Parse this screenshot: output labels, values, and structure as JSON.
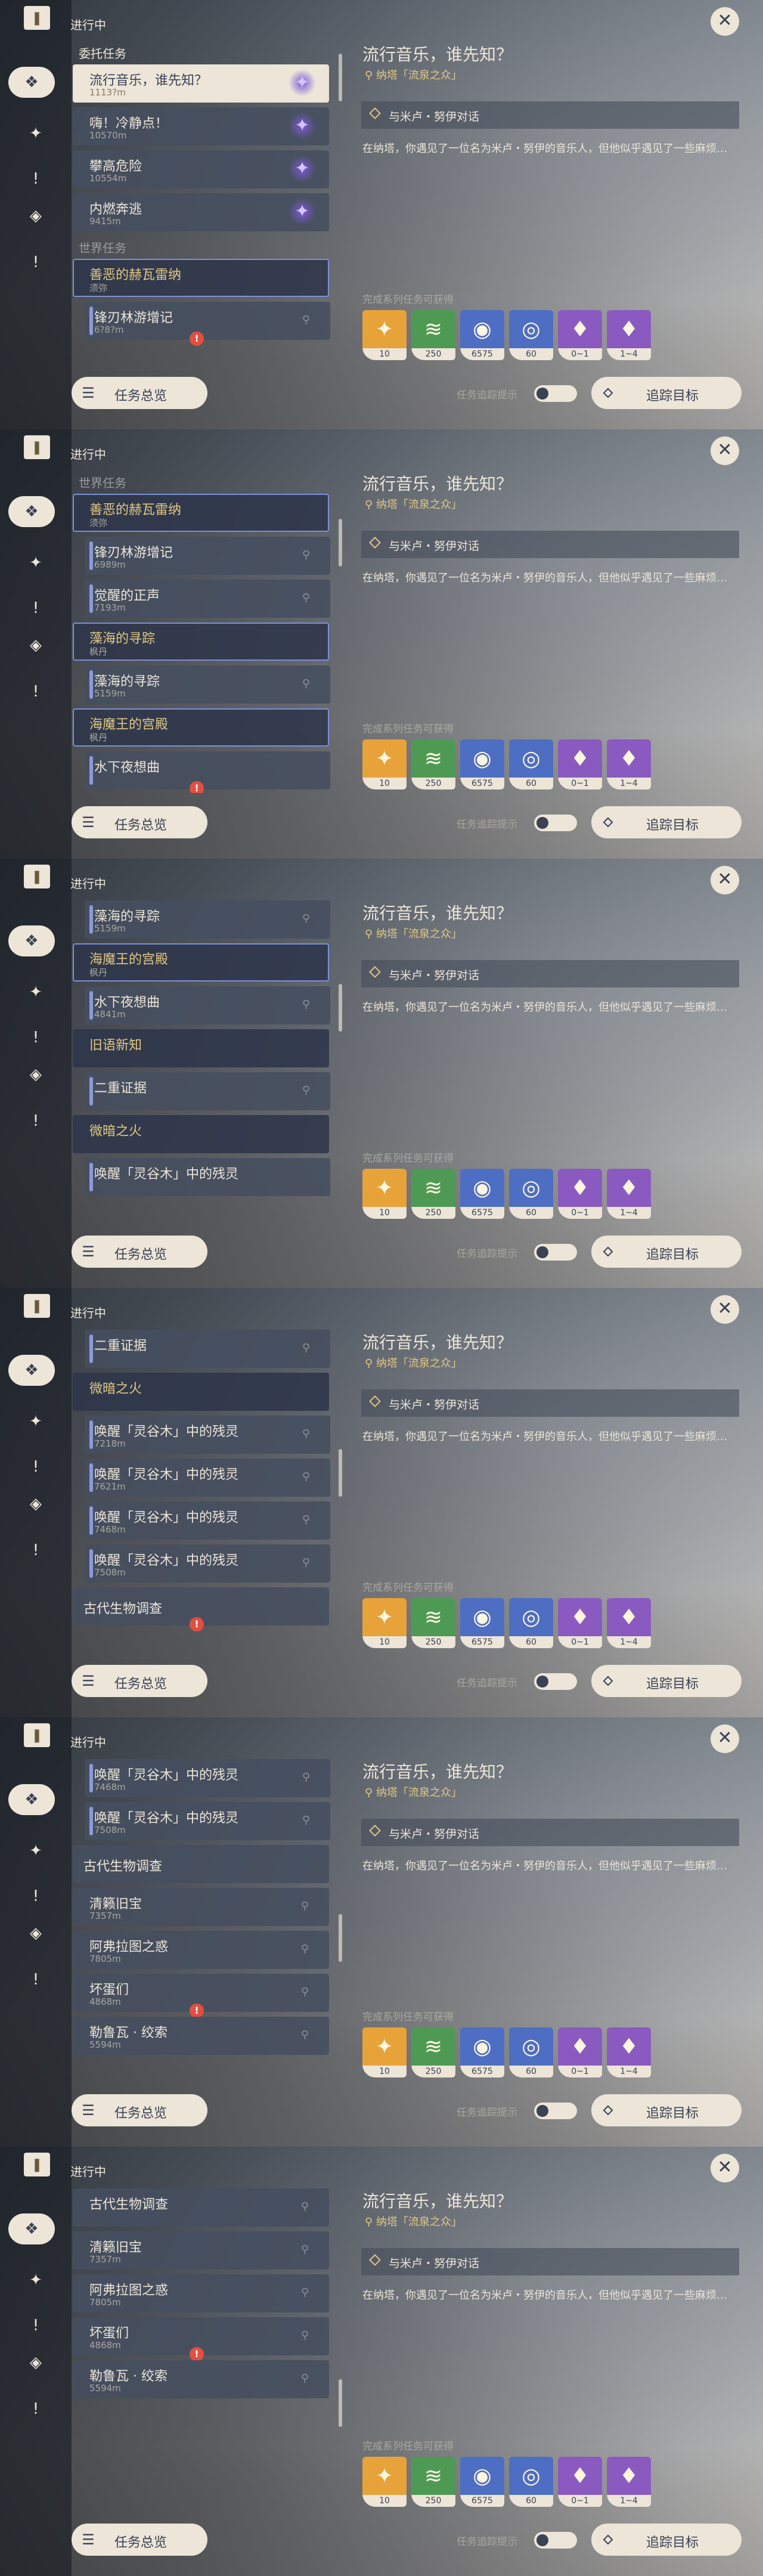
{
  "header": "进行中",
  "bottom_button": "任务总览",
  "close_symbol": "✕",
  "quest": {
    "title": "流行音乐，谁先知？",
    "location": "纳塔「流泉之众」",
    "objective": "与米卢・努伊对话",
    "description": "在纳塔，你遇见了一位名为米卢・努伊的音乐人，但他似乎遇见了一些麻烦…",
    "rewards_label": "完成系列任务可获得",
    "track_toggle_label": "任务追踪提示",
    "track_button": "追踪目标"
  },
  "rewards": [
    {
      "name": "intertwined-fate",
      "count": "10",
      "color": "#e8a23a"
    },
    {
      "name": "adventure-exp",
      "count": "250",
      "color": "#4e9a55"
    },
    {
      "name": "mora",
      "count": "6575",
      "color": "#4d6ec2"
    },
    {
      "name": "companionship-exp",
      "count": "60",
      "color": "#4d6ec2"
    },
    {
      "name": "crystal-fragment",
      "count": "0~1",
      "color": "#8a5ac0"
    },
    {
      "name": "crystal-chunk",
      "count": "1~4",
      "color": "#8a5ac0"
    }
  ],
  "rail_icons": [
    "quest-book-icon",
    "quest-diamond-icon",
    "archon-quest-icon",
    "alert-icon",
    "compass-icon",
    "exclamation-icon"
  ],
  "frames": [
    {
      "items": [
        {
          "kind": "section",
          "text": "委托任务"
        },
        {
          "kind": "row",
          "style": "cur",
          "title": "流行音乐，谁先知？",
          "dist": "1113?m",
          "star": true
        },
        {
          "kind": "row",
          "title": "嗨！冷静点！",
          "dist": "10570m",
          "star": true
        },
        {
          "kind": "row",
          "title": "攀高危险",
          "dist": "10554m",
          "star": true
        },
        {
          "kind": "row",
          "title": "内燃奔逃",
          "dist": "9415m",
          "star": true
        },
        {
          "kind": "section",
          "text": "世界任务",
          "dim": true
        },
        {
          "kind": "row",
          "style": "hdrrow open",
          "title": "善恶的赫瓦雷纳",
          "dist": "须弥"
        },
        {
          "kind": "row",
          "style": "sub",
          "title": "锋刃林游增记",
          "dist": "6?8?m",
          "pin": true,
          "warn": true
        }
      ]
    },
    {
      "items": [
        {
          "kind": "section",
          "text": "世界任务",
          "dim": true
        },
        {
          "kind": "row",
          "style": "hdrrow open",
          "title": "善恶的赫瓦雷纳",
          "dist": "须弥"
        },
        {
          "kind": "row",
          "style": "sub",
          "title": "锋刃林游增记",
          "dist": "6989m",
          "pin": true
        },
        {
          "kind": "row",
          "style": "sub",
          "title": "觉醒的正声",
          "dist": "7193m",
          "pin": true
        },
        {
          "kind": "row",
          "style": "hdrrow open",
          "title": "藻海的寻踪",
          "dist": "枫丹"
        },
        {
          "kind": "row",
          "style": "sub",
          "title": "藻海的寻踪",
          "dist": "5159m",
          "pin": true
        },
        {
          "kind": "row",
          "style": "hdrrow open",
          "title": "海魔王的宫殿",
          "dist": "枫丹"
        },
        {
          "kind": "row",
          "style": "sub",
          "title": "水下夜想曲",
          "dist": "",
          "warn": true
        }
      ]
    },
    {
      "items": [
        {
          "kind": "row",
          "style": "sub",
          "title": "藻海的寻踪",
          "dist": "5159m",
          "pin": true
        },
        {
          "kind": "row",
          "style": "hdrrow open",
          "title": "海魔王的宫殿",
          "dist": "枫丹"
        },
        {
          "kind": "row",
          "style": "sub",
          "title": "水下夜想曲",
          "dist": "4841m",
          "pin": true
        },
        {
          "kind": "row",
          "style": "hdrrow",
          "title": "旧语新知",
          "dist": ""
        },
        {
          "kind": "row",
          "style": "sub",
          "title": "二重证据",
          "dist": "",
          "pin": true
        },
        {
          "kind": "row",
          "style": "hdrrow",
          "title": "微暗之火",
          "dist": ""
        },
        {
          "kind": "row",
          "style": "sub",
          "title": "唤醒「灵谷木」中的残灵",
          "dist": ""
        }
      ]
    },
    {
      "items": [
        {
          "kind": "row",
          "style": "sub",
          "title": "二重证据",
          "dist": "",
          "pin": true
        },
        {
          "kind": "row",
          "style": "hdrrow",
          "title": "微暗之火",
          "dist": ""
        },
        {
          "kind": "row",
          "style": "sub",
          "title": "唤醒「灵谷木」中的残灵",
          "dist": "7218m",
          "pin": true
        },
        {
          "kind": "row",
          "style": "sub",
          "title": "唤醒「灵谷木」中的残灵",
          "dist": "7621m",
          "pin": true
        },
        {
          "kind": "row",
          "style": "sub",
          "title": "唤醒「灵谷木」中的残灵",
          "dist": "7468m",
          "pin": true
        },
        {
          "kind": "row",
          "style": "sub",
          "title": "唤醒「灵谷木」中的残灵",
          "dist": "7508m",
          "pin": true
        },
        {
          "kind": "row",
          "style": "plain",
          "title": "古代生物调查",
          "dist": "",
          "warn": true
        }
      ]
    },
    {
      "items": [
        {
          "kind": "row",
          "style": "sub",
          "title": "唤醒「灵谷木」中的残灵",
          "dist": "7468m",
          "pin": true
        },
        {
          "kind": "row",
          "style": "sub",
          "title": "唤醒「灵谷木」中的残灵",
          "dist": "7508m",
          "pin": true
        },
        {
          "kind": "row",
          "style": "plain",
          "title": "古代生物调查",
          "dist": ""
        },
        {
          "kind": "row",
          "title": "清籁旧宝",
          "dist": "7357m",
          "pin": true
        },
        {
          "kind": "row",
          "title": "阿弗拉图之惑",
          "dist": "7805m",
          "pin": true
        },
        {
          "kind": "row",
          "title": "坏蛋们",
          "dist": "4868m",
          "pin": true,
          "warn": true
        },
        {
          "kind": "row",
          "title": "勒鲁瓦 · 绞索",
          "dist": "5594m",
          "pin": true
        }
      ]
    },
    {
      "items": [
        {
          "kind": "row",
          "title": "古代生物调查",
          "dist": "",
          "pin": true
        },
        {
          "kind": "row",
          "title": "清籁旧宝",
          "dist": "7357m",
          "pin": true
        },
        {
          "kind": "row",
          "title": "阿弗拉图之惑",
          "dist": "7805m",
          "pin": true
        },
        {
          "kind": "row",
          "title": "坏蛋们",
          "dist": "4868m",
          "pin": true,
          "warn": true
        },
        {
          "kind": "row",
          "title": "勒鲁瓦 · 绞索",
          "dist": "5594m",
          "pin": true
        }
      ]
    }
  ]
}
